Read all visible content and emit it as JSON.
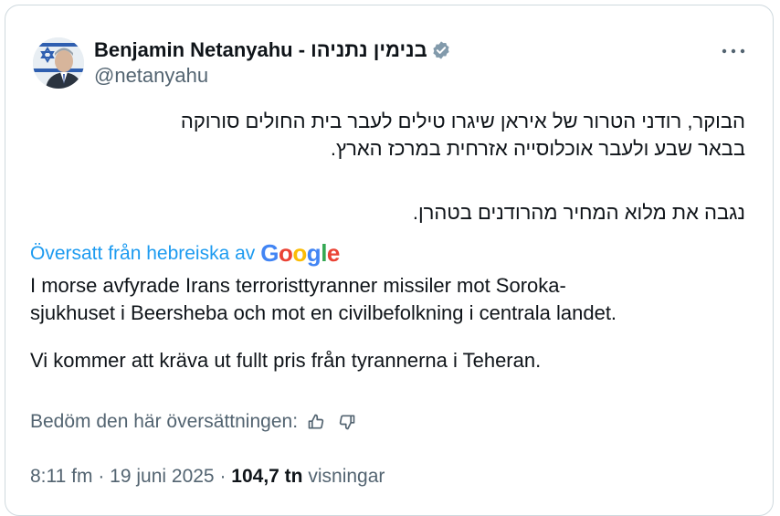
{
  "author": {
    "name": "Benjamin Netanyahu - בנימין נתניהו",
    "handle": "@netanyahu",
    "verified_color": "#829aab"
  },
  "tweet": {
    "hebrew_lines": [
      "הבוקר, רודני הטרור של איראן שיגרו טילים לעבר בית החולים סורוקה",
      "בבאר שבע ולעבר אוכלוסייה אזרחית במרכז הארץ.",
      "נגבה את מלוא המחיר מהרודנים בטהרן."
    ],
    "translated_by_label": "Översatt från hebreiska av",
    "translated_by_brand": "Google",
    "translation_lines": [
      "I morse avfyrade Irans terroristtyranner missiler mot Soroka-",
      "sjukhuset i Beersheba och mot en civilbefolkning i centrala landet.",
      "Vi kommer att kräva ut fullt pris från tyrannerna i Teheran."
    ],
    "rate_label": "Bedöm den här översättningen:",
    "time": "8:11 fm",
    "separator": "·",
    "date": "19 juni 2025",
    "views_count": "104,7 tn",
    "views_label": "visningar"
  },
  "colors": {
    "link": "#1d9bf0",
    "secondary_text": "#536471",
    "primary_text": "#0f1419",
    "border": "#cfd9de"
  }
}
